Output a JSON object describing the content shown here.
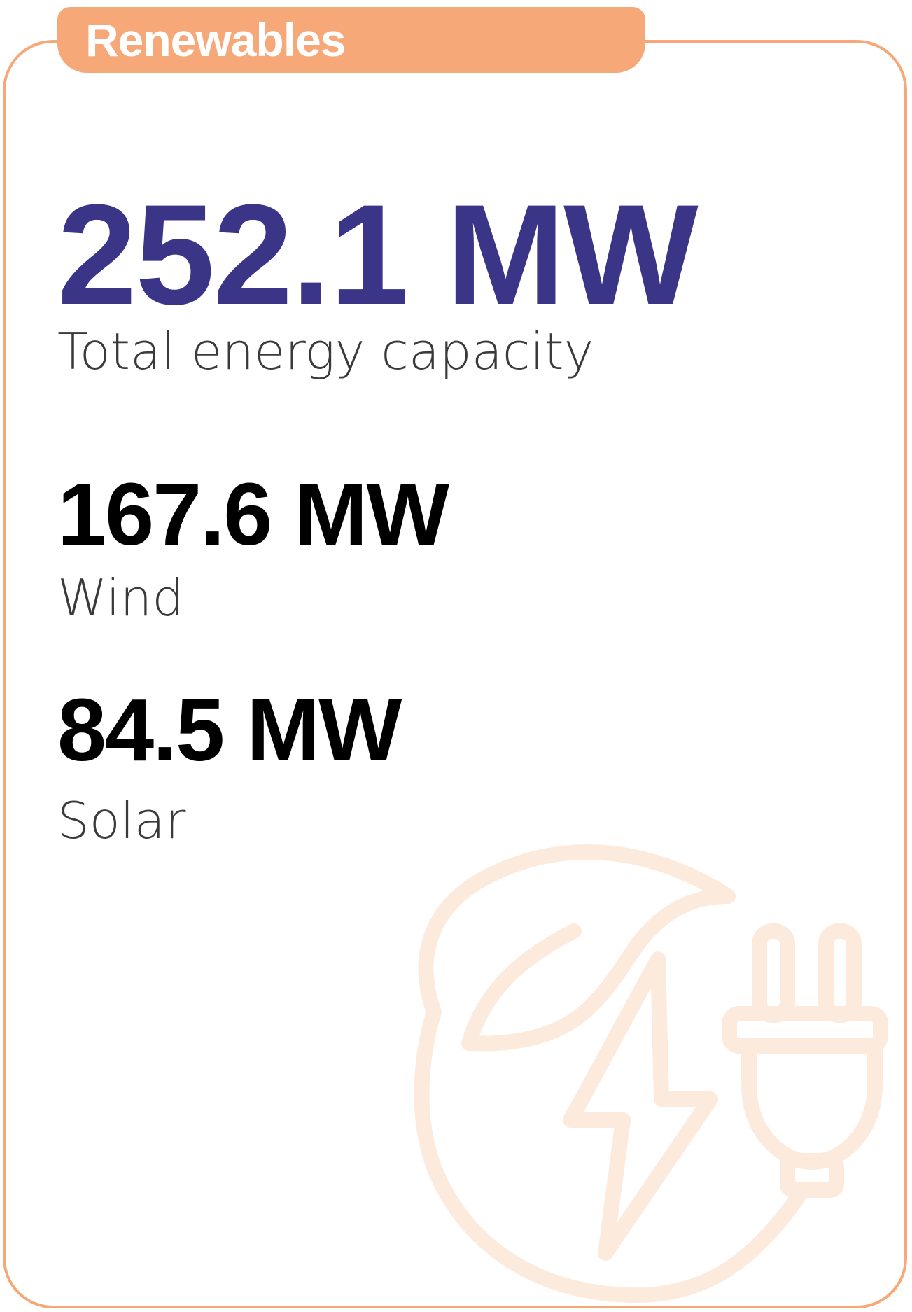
{
  "header": {
    "label": "Renewables"
  },
  "total": {
    "value": "252.1 MW",
    "label": "Total energy capacity"
  },
  "wind": {
    "value": "167.6 MW",
    "label": "Wind"
  },
  "solar": {
    "value": "84.5 MW",
    "label": "Solar"
  },
  "colors": {
    "accent": "#F6A878",
    "primary_value": "#3A3586",
    "secondary_value": "#000000",
    "label_text": "#3a3a3a",
    "illustration_stroke": "#FCEBDD"
  },
  "icons": {
    "illustration": "renewable-energy-plug-icon"
  }
}
